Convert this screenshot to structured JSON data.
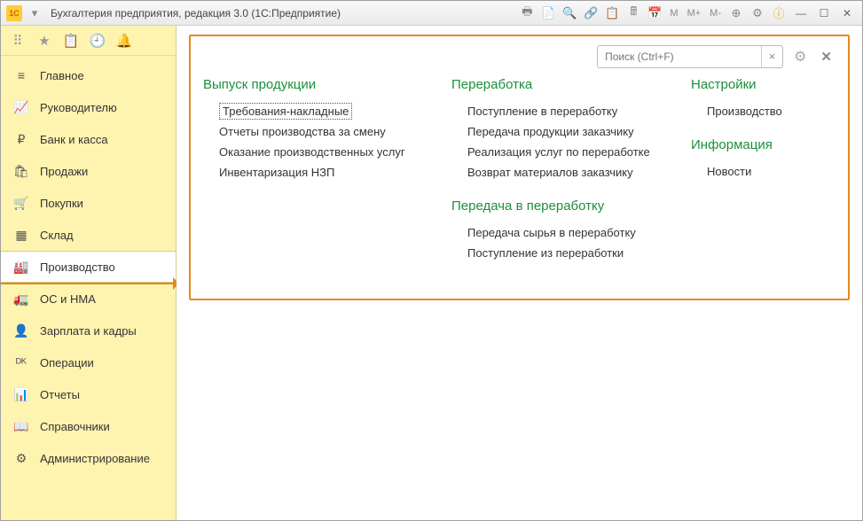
{
  "titlebar": {
    "app_badge": "1C",
    "title": "Бухгалтерия предприятия, редакция 3.0  (1С:Предприятие)",
    "mem_labels": [
      "M",
      "M+",
      "M-"
    ]
  },
  "side_top_icons": [
    "grid",
    "star",
    "clipboard",
    "clock",
    "bell"
  ],
  "sidebar": {
    "items": [
      {
        "label": "Главное",
        "icon": "menu"
      },
      {
        "label": "Руководителю",
        "icon": "trend"
      },
      {
        "label": "Банк и касса",
        "icon": "ruble"
      },
      {
        "label": "Продажи",
        "icon": "bag"
      },
      {
        "label": "Покупки",
        "icon": "cart"
      },
      {
        "label": "Склад",
        "icon": "boxes"
      },
      {
        "label": "Производство",
        "icon": "factory",
        "active": true
      },
      {
        "label": "ОС и НМА",
        "icon": "truck"
      },
      {
        "label": "Зарплата и кадры",
        "icon": "person"
      },
      {
        "label": "Операции",
        "icon": "dtkt"
      },
      {
        "label": "Отчеты",
        "icon": "chart"
      },
      {
        "label": "Справочники",
        "icon": "book"
      },
      {
        "label": "Администрирование",
        "icon": "gear"
      }
    ]
  },
  "panel": {
    "search_placeholder": "Поиск (Ctrl+F)",
    "clear_label": "×",
    "columns": [
      {
        "sections": [
          {
            "title": "Выпуск продукции",
            "links": [
              {
                "label": "Требования-накладные",
                "highlighted": true
              },
              {
                "label": "Отчеты производства за смену"
              },
              {
                "label": "Оказание производственных услуг"
              },
              {
                "label": "Инвентаризация НЗП"
              }
            ]
          }
        ]
      },
      {
        "sections": [
          {
            "title": "Переработка",
            "links": [
              {
                "label": "Поступление в переработку"
              },
              {
                "label": "Передача продукции заказчику"
              },
              {
                "label": "Реализация услуг по переработке"
              },
              {
                "label": "Возврат материалов заказчику"
              }
            ]
          },
          {
            "title": "Передача в переработку",
            "links": [
              {
                "label": "Передача сырья в переработку"
              },
              {
                "label": "Поступление из переработки"
              }
            ]
          }
        ]
      },
      {
        "sections": [
          {
            "title": "Настройки",
            "links": [
              {
                "label": "Производство"
              }
            ]
          },
          {
            "title": "Информация",
            "links": [
              {
                "label": "Новости"
              }
            ]
          }
        ]
      }
    ]
  }
}
